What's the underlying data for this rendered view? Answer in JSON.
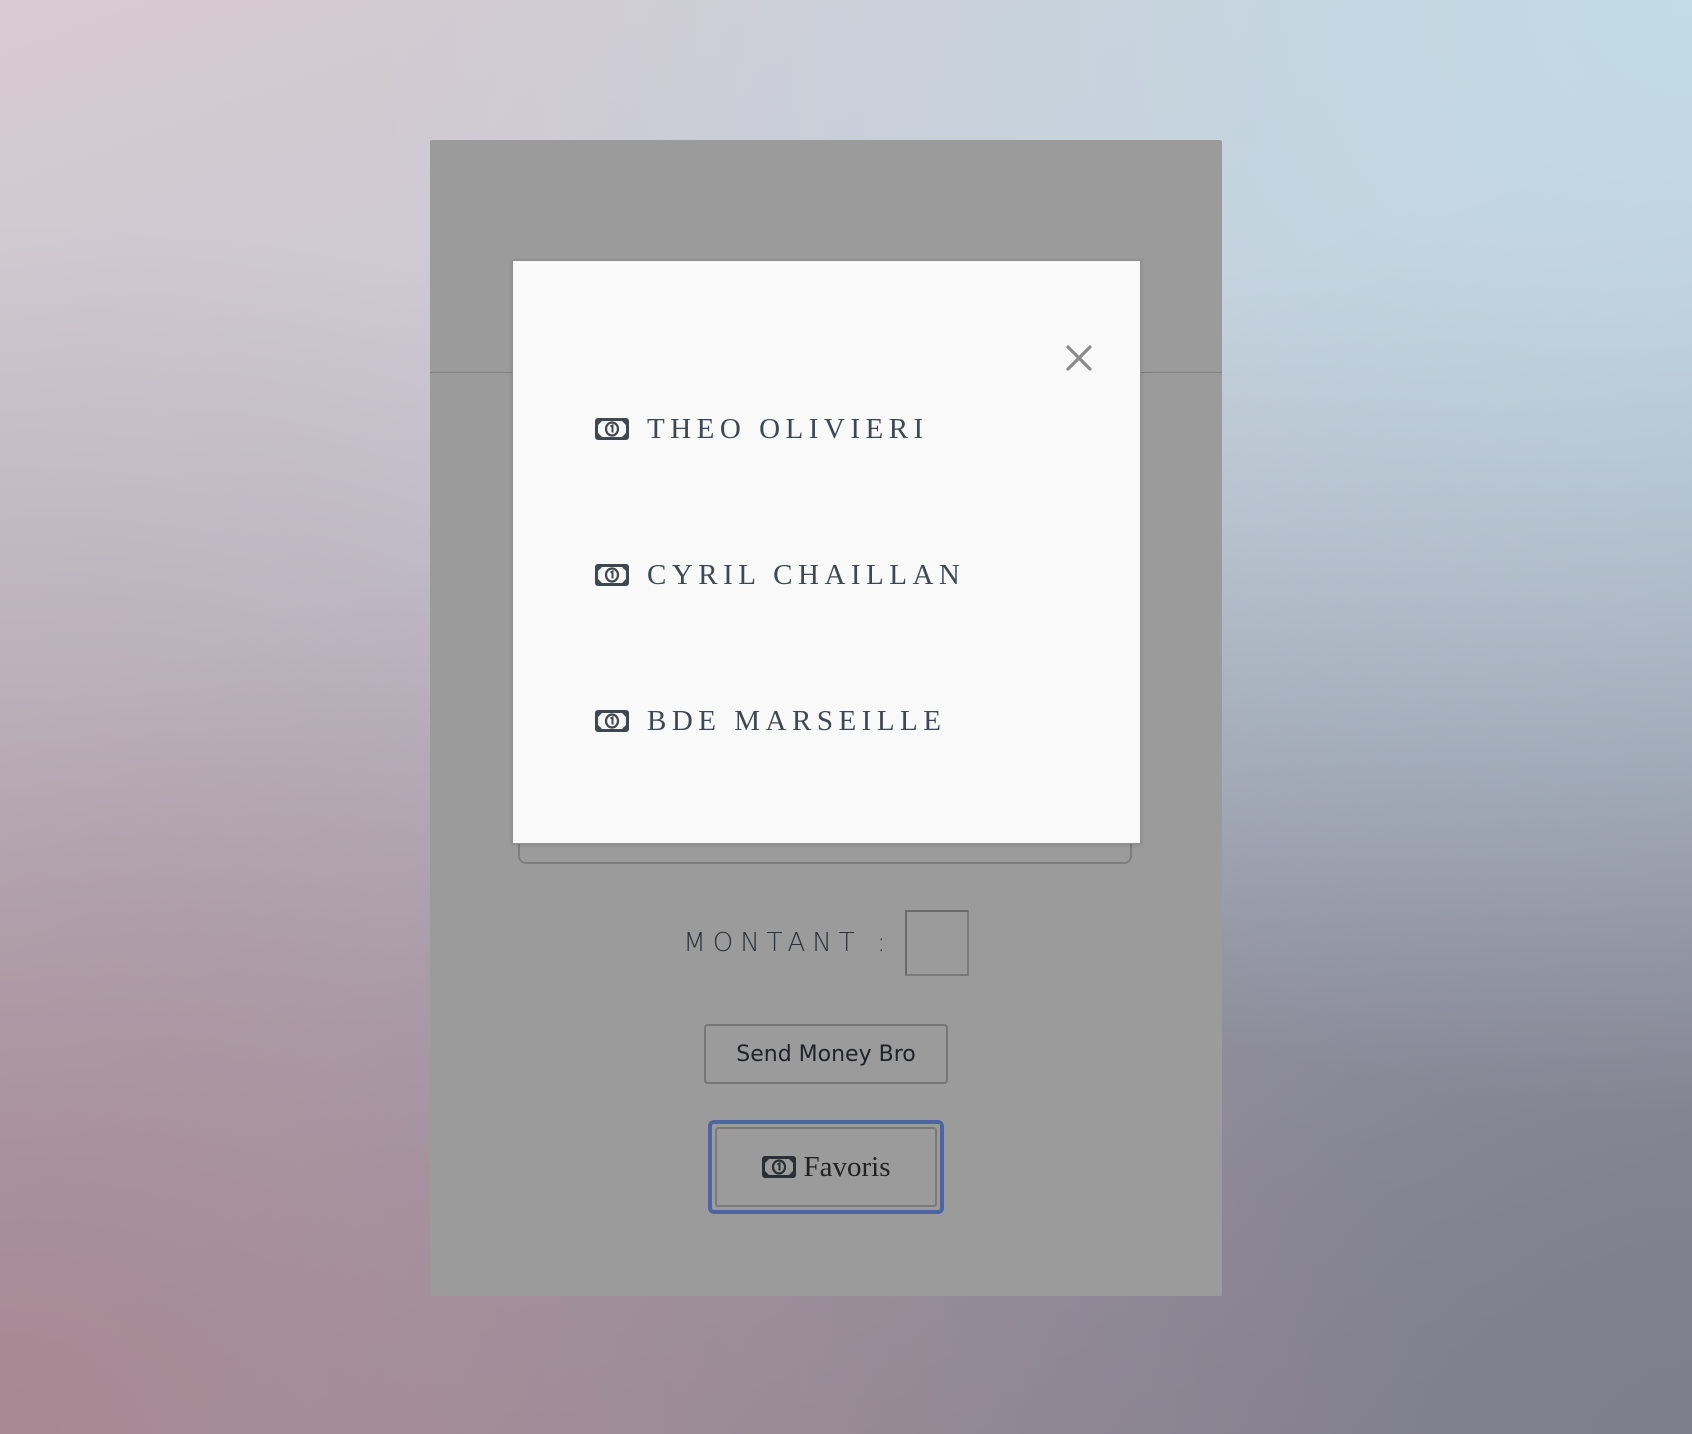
{
  "background": {
    "top_right": "#c2dbe6",
    "bottom_left": "#a88892"
  },
  "card": {
    "amount_label": "MONTANT :",
    "amount_value": "",
    "send_button_label": "Send Money Bro",
    "favorites_button_label": "Favoris",
    "favorites_button_icon": "money-bill-icon",
    "focus_ring_color": "#4d66a3"
  },
  "modal": {
    "close_icon": "close-icon",
    "favorites": [
      {
        "icon": "money-bill-icon",
        "name": "THEO OLIVIERI"
      },
      {
        "icon": "money-bill-icon",
        "name": "CYRIL CHAILLAN"
      },
      {
        "icon": "money-bill-icon",
        "name": "BDE MARSEILLE"
      }
    ]
  }
}
